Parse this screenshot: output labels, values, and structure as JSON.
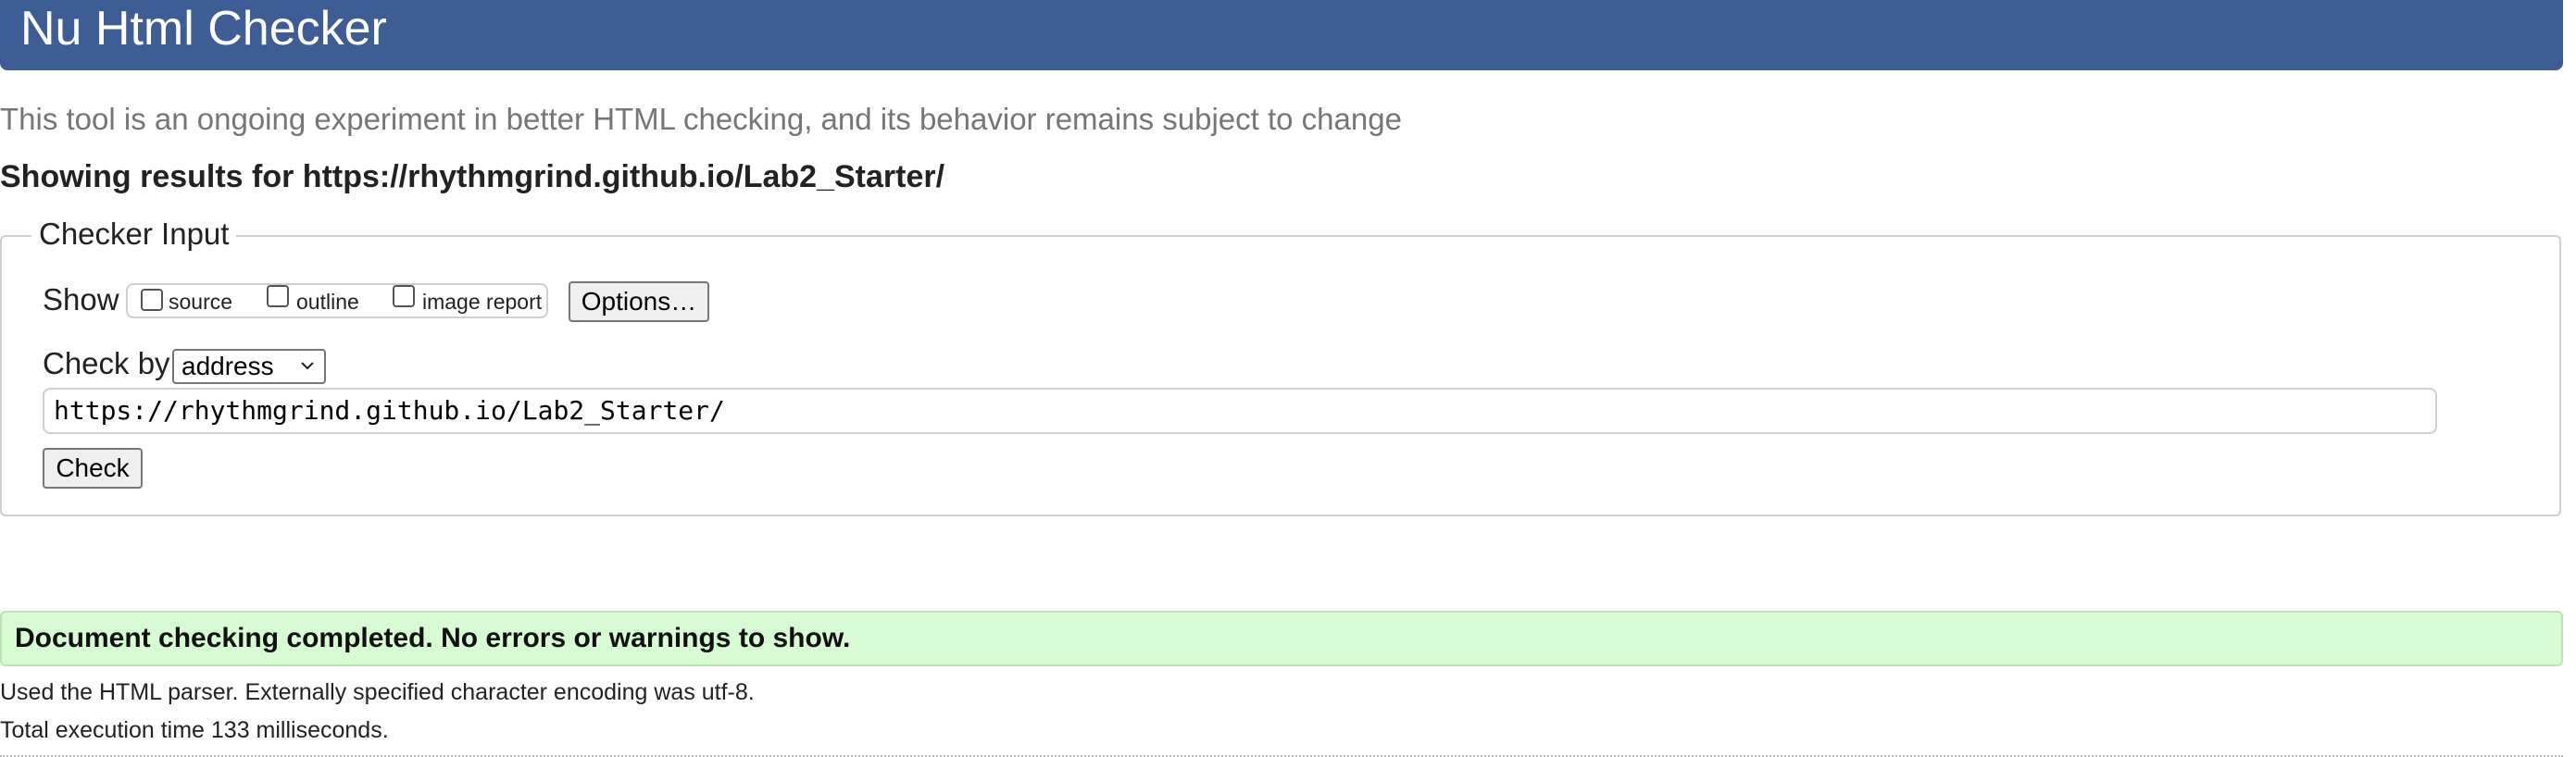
{
  "header": {
    "title": "Nu Html Checker"
  },
  "subtitle": "This tool is an ongoing experiment in better HTML checking, and its behavior remains subject to change",
  "results_for": "Showing results for https://rhythmgrind.github.io/Lab2_Starter/",
  "checker_input": {
    "legend": "Checker Input",
    "show_label": "Show",
    "show_options": [
      {
        "label": "source",
        "checked": false
      },
      {
        "label": "outline",
        "checked": false
      },
      {
        "label": "image report",
        "checked": false
      }
    ],
    "options_button": "Options…",
    "check_by_label": "Check by",
    "check_by_selected": "address",
    "url_value": "https://rhythmgrind.github.io/Lab2_Starter/",
    "check_button": "Check"
  },
  "result": {
    "message": "Document checking completed. No errors or warnings to show.",
    "parser_info": "Used the HTML parser. Externally specified character encoding was utf-8.",
    "execution_time": "Total execution time 133 milliseconds."
  },
  "colors": {
    "header_bg": "#3e5d94",
    "success_bg": "#d7fcd4",
    "subtitle_text": "#767676"
  }
}
